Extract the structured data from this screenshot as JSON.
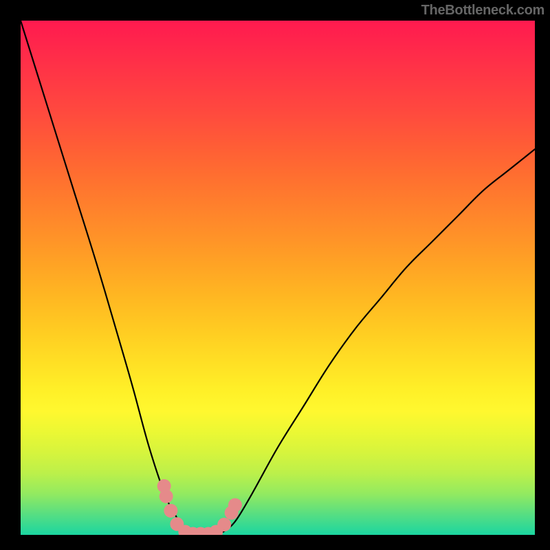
{
  "attribution": "TheBottleneck.com",
  "chart_data": {
    "type": "line",
    "title": "",
    "xlabel": "",
    "ylabel": "",
    "xlim": [
      0,
      100
    ],
    "ylim": [
      0,
      100
    ],
    "x": [
      0,
      5,
      10,
      15,
      20,
      22,
      25,
      28,
      30,
      32,
      34,
      36,
      38,
      40,
      42,
      45,
      50,
      55,
      60,
      65,
      70,
      75,
      80,
      85,
      90,
      95,
      100
    ],
    "values": [
      100,
      84,
      68,
      52,
      35,
      28,
      17,
      8,
      4,
      1,
      0,
      0,
      0,
      1,
      3,
      8,
      17,
      25,
      33,
      40,
      46,
      52,
      57,
      62,
      67,
      71,
      75
    ],
    "series": [
      {
        "name": "bottleneck-curve",
        "color": "#000000"
      }
    ],
    "markers": {
      "color": "#e58a8a",
      "points": [
        {
          "x": 27.9,
          "y": 9.5
        },
        {
          "x": 28.3,
          "y": 7.5
        },
        {
          "x": 29.2,
          "y": 4.7
        },
        {
          "x": 30.4,
          "y": 2.1
        },
        {
          "x": 32.0,
          "y": 0.6
        },
        {
          "x": 33.5,
          "y": 0.2
        },
        {
          "x": 35.0,
          "y": 0.2
        },
        {
          "x": 36.5,
          "y": 0.2
        },
        {
          "x": 38.0,
          "y": 0.6
        },
        {
          "x": 39.6,
          "y": 2.0
        },
        {
          "x": 41.0,
          "y": 4.3
        },
        {
          "x": 41.7,
          "y": 5.8
        }
      ]
    },
    "gradient_stops": [
      {
        "pct": 0,
        "color": "#ff1a4f"
      },
      {
        "pct": 50,
        "color": "#ffa524"
      },
      {
        "pct": 75,
        "color": "#fff028"
      },
      {
        "pct": 100,
        "color": "#1bd6a0"
      }
    ]
  }
}
